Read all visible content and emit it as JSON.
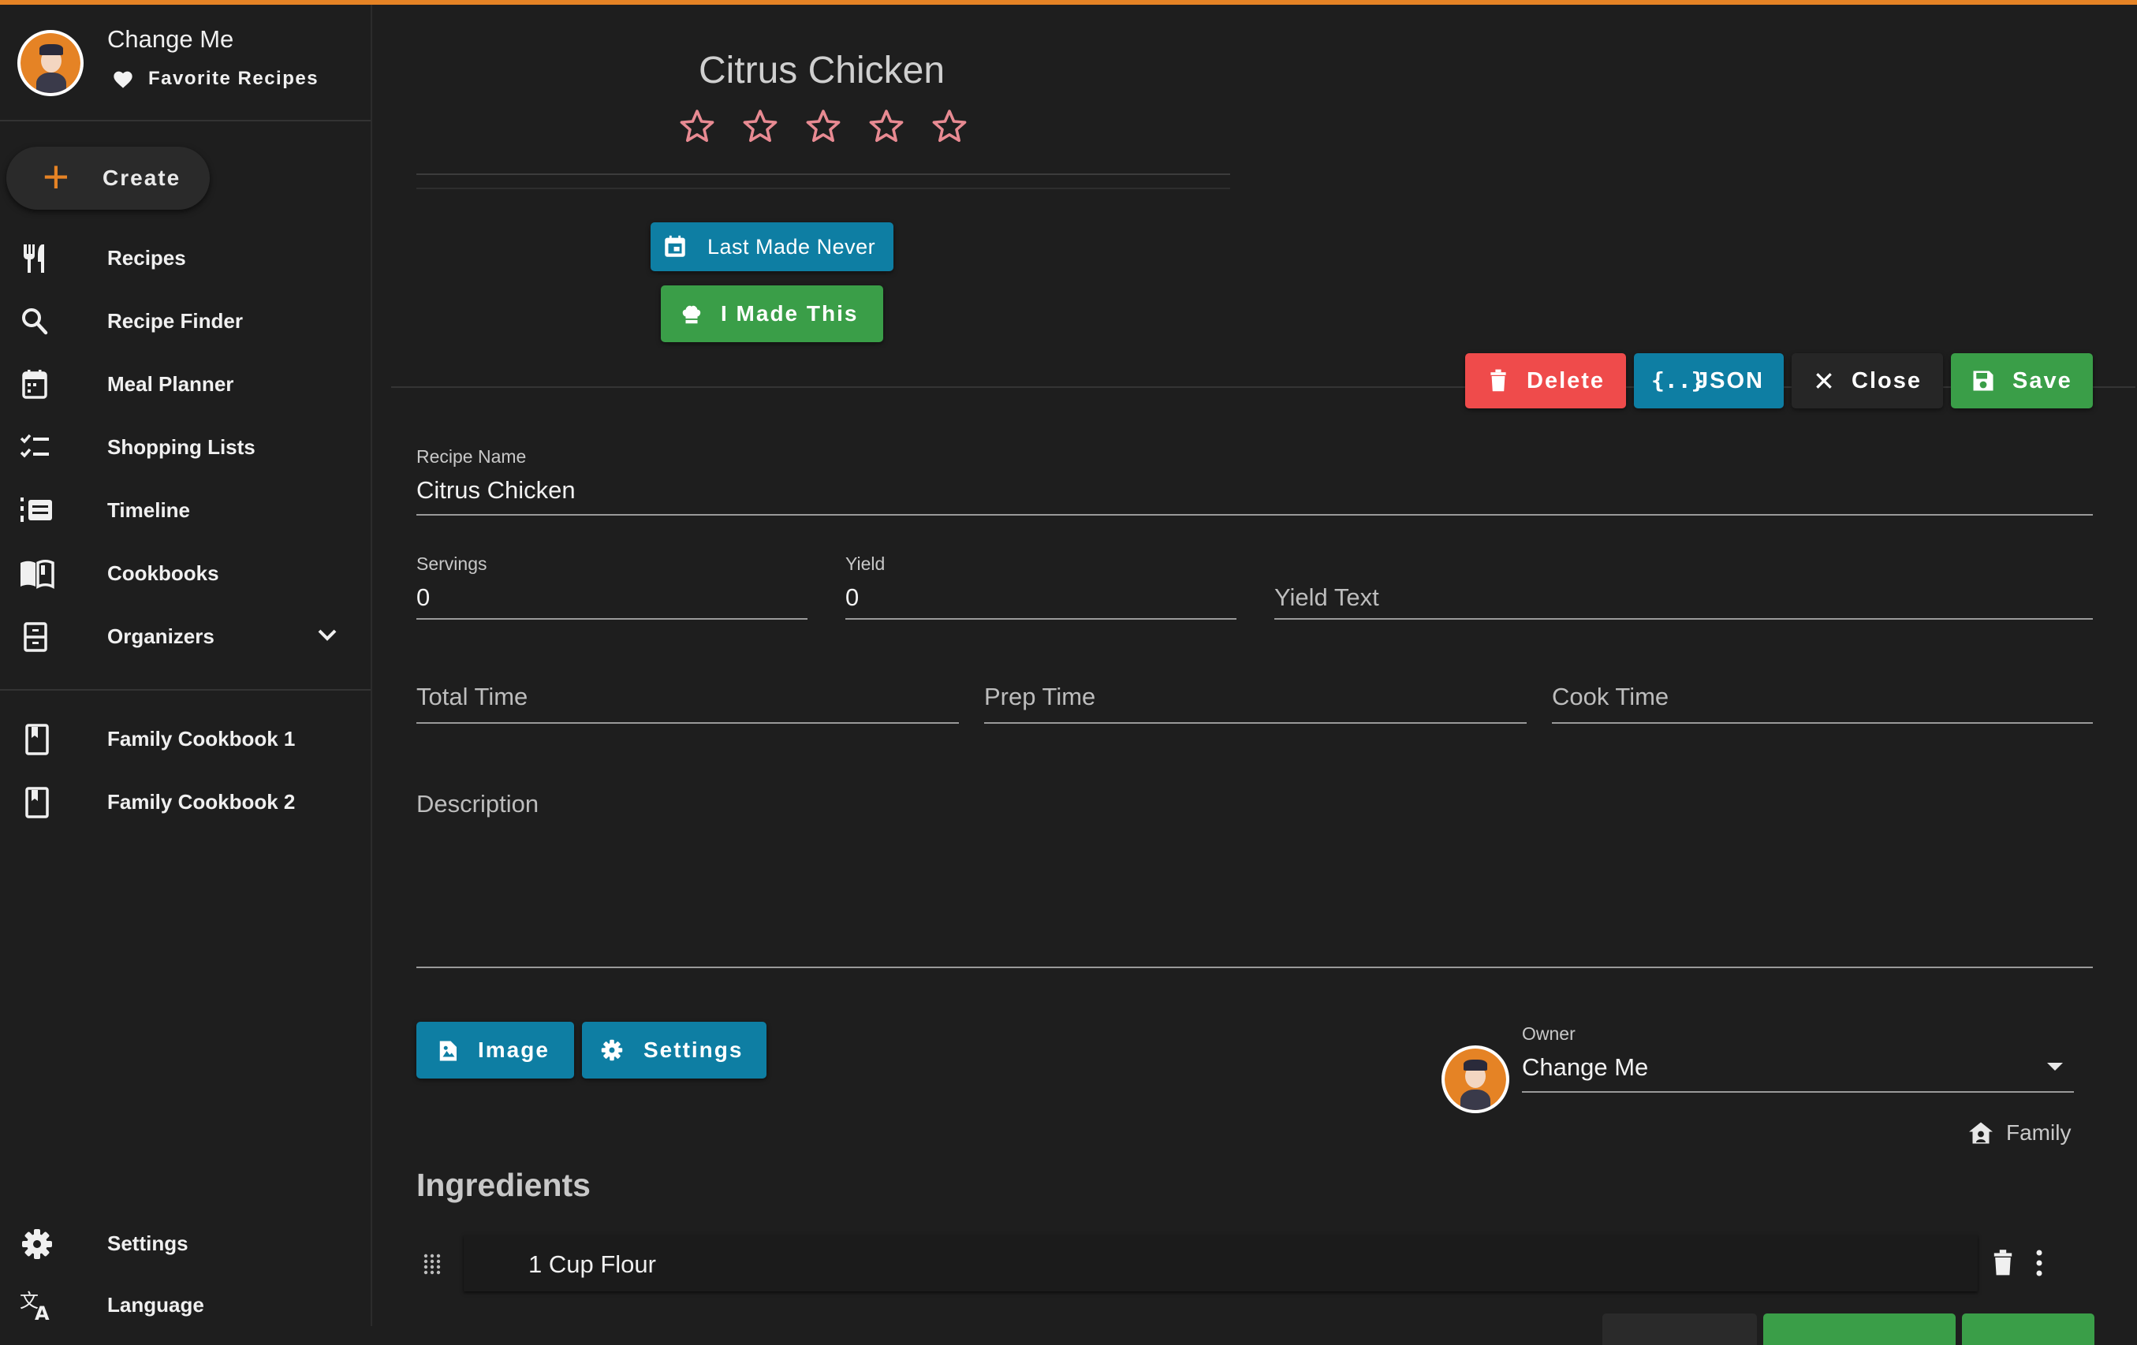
{
  "colors": {
    "accent": "#e58325",
    "blue": "#0e7ea3",
    "green": "#3a9e48",
    "red": "#ef4b4b",
    "star": "#e88a92"
  },
  "user": {
    "name": "Change Me",
    "favorites_label": "Favorite Recipes"
  },
  "sidebar": {
    "create_label": "Create",
    "items": [
      {
        "label": "Recipes",
        "icon": "fork-knife-icon"
      },
      {
        "label": "Recipe Finder",
        "icon": "search-icon"
      },
      {
        "label": "Meal Planner",
        "icon": "calendar-icon"
      },
      {
        "label": "Shopping Lists",
        "icon": "checklist-icon"
      },
      {
        "label": "Timeline",
        "icon": "timeline-icon"
      },
      {
        "label": "Cookbooks",
        "icon": "book-open-icon"
      },
      {
        "label": "Organizers",
        "icon": "organizer-icon"
      }
    ],
    "cookbooks": [
      {
        "label": "Family Cookbook 1"
      },
      {
        "label": "Family Cookbook 2"
      }
    ],
    "bottom": [
      {
        "label": "Settings",
        "icon": "gear-icon"
      },
      {
        "label": "Language",
        "icon": "translate-icon"
      }
    ]
  },
  "recipe": {
    "title": "Citrus Chicken",
    "rating": 0,
    "last_made_label": "Last Made Never",
    "made_this_label": "I Made This"
  },
  "actions": {
    "delete": "Delete",
    "json": "JSON",
    "close": "Close",
    "save": "Save"
  },
  "form": {
    "recipe_name_label": "Recipe Name",
    "recipe_name_value": "Citrus Chicken",
    "servings_label": "Servings",
    "servings_value": "0",
    "yield_label": "Yield",
    "yield_value": "0",
    "yield_text_placeholder": "Yield Text",
    "total_time_placeholder": "Total Time",
    "prep_time_placeholder": "Prep Time",
    "cook_time_placeholder": "Cook Time",
    "description_placeholder": "Description",
    "image_label": "Image",
    "settings_label": "Settings",
    "owner_label": "Owner",
    "owner_value": "Change Me",
    "household_label": "Family"
  },
  "ingredients": {
    "title": "Ingredients",
    "items": [
      {
        "text": "1 Cup Flour"
      }
    ]
  }
}
